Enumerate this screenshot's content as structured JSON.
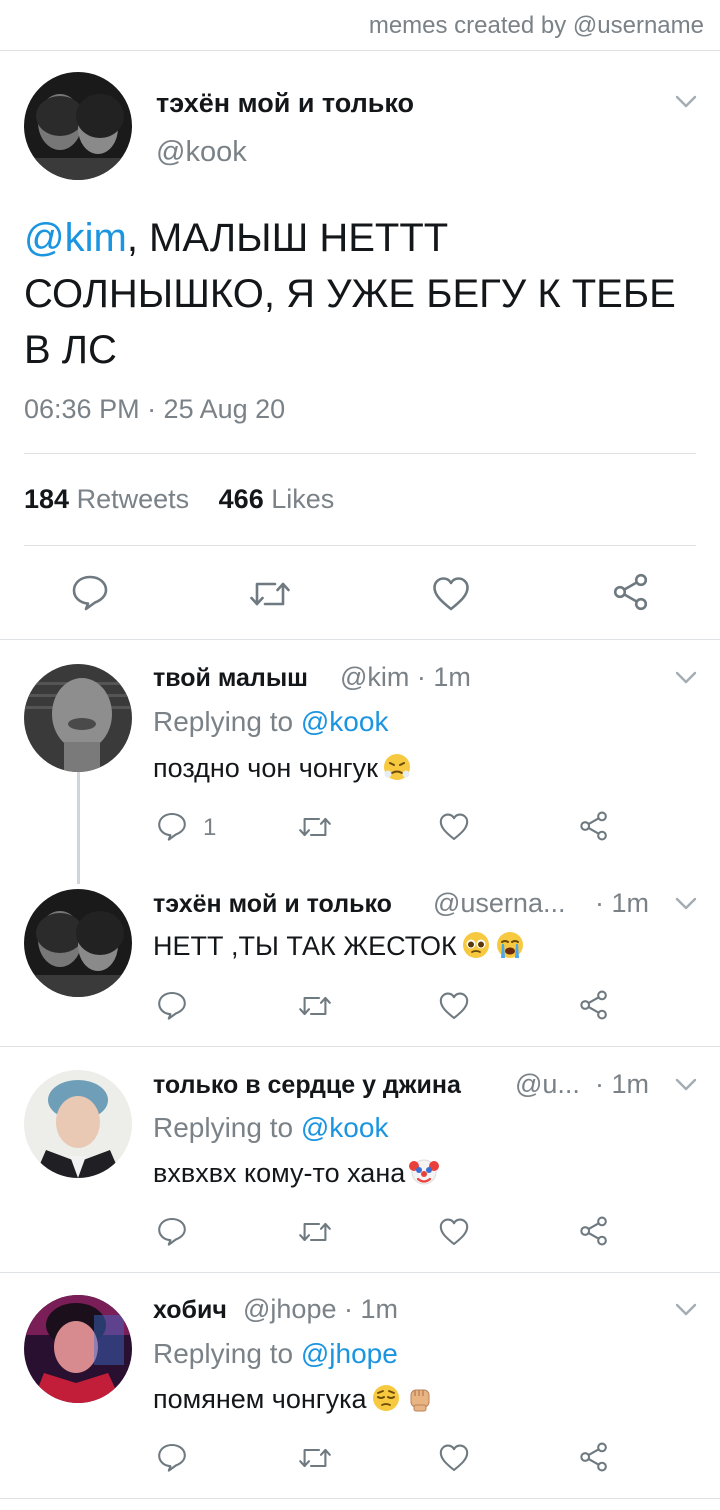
{
  "watermark": "memes created by @username",
  "main_tweet": {
    "name": "тэхён мой и только",
    "handle": "@kook",
    "mention": "@kim",
    "text_rest": ", МАЛЫШ НЕТТТ СОЛНЫШКО, Я УЖЕ БЕГУ К ТЕБЕ В ЛС",
    "timestamp": "06:36 PM · 25 Aug 20",
    "retweets_count": "184",
    "retweets_label": "Retweets",
    "likes_count": "466",
    "likes_label": "Likes",
    "actions": [
      "reply-icon",
      "retweet-icon",
      "like-icon",
      "share-icon"
    ]
  },
  "replies": [
    {
      "name": "твой малыш",
      "handle": "@kim · 1m",
      "time": "",
      "replying_prefix": "Replying to",
      "replying_to": "@kook",
      "text": "поздно чон чонгук",
      "emojis": [
        "steam-face-emoji"
      ],
      "reply_count": "1"
    },
    {
      "name": "тэхён мой и только",
      "handle": "@userna...",
      "time": "· 1m",
      "text": "НЕТТ ,ТЫ ТАК ЖЕСТОК",
      "emojis": [
        "pleading-face-emoji",
        "crying-face-emoji"
      ]
    },
    {
      "name": "только в сердце у джина",
      "handle": "@u...",
      "time": "· 1m",
      "replying_prefix": "Replying to",
      "replying_to": "@kook",
      "text": "вхвхвх кому-то хана",
      "emojis": [
        "clown-face-emoji"
      ]
    },
    {
      "name": "хобич",
      "handle": "@jhope · 1m",
      "time": "",
      "replying_prefix": "Replying to",
      "replying_to": "@jhope",
      "text": "помянем чонгука",
      "emojis": [
        "pensive-face-emoji",
        "raised-fist-emoji"
      ]
    }
  ],
  "colors": {
    "link": "#1b95e0",
    "muted": "#7a8288",
    "text": "#14171a",
    "divider": "#dfe3e6",
    "icon": "#6e7980"
  }
}
